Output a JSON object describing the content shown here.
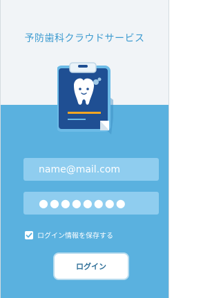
{
  "app": {
    "title": "予防歯科クラウドサービス"
  },
  "form": {
    "email_value": "name@mail.com",
    "password_value": "●●●●●●●●",
    "remember_label": "ログイン情報を保存する",
    "remember_checked": true,
    "login_label": "ログイン"
  },
  "colors": {
    "accent": "#3d9bd0",
    "panel": "#5ab1df",
    "field": "#8fcdef",
    "clipboard": "#1f4f93"
  },
  "icons": {
    "illustration": "tooth-clipboard-icon",
    "checkbox": "checkmark-icon"
  }
}
